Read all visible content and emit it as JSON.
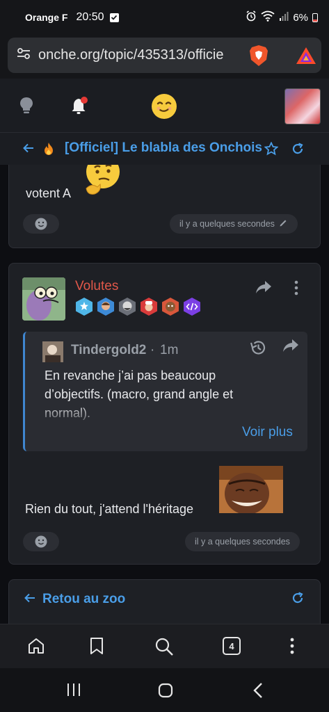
{
  "status_bar": {
    "carrier": "Orange F",
    "time": "20:50",
    "battery": "6%"
  },
  "browser": {
    "url": "onche.org/topic/435313/officie",
    "tab_count": "4"
  },
  "topic": {
    "title": "[Officiel] Le blabla des Onchois"
  },
  "posts": [
    {
      "text": "votent A",
      "time": "il y a quelques secondes"
    },
    {
      "author": "Volutes",
      "quote": {
        "author": "Tindergold2",
        "separator": "·",
        "time": "1m",
        "text": "En revanche j’ai pas beaucoup d’objectifs. (macro, grand angle et normal).",
        "more_label": "Voir plus"
      },
      "text": "Rien du tout, j'attend l'héritage",
      "time": "il y a quelques secondes"
    }
  ],
  "footer_link": {
    "label": "Retou au zoo"
  },
  "colors": {
    "accent": "#4a9ee8",
    "author": "#e2584a",
    "card": "#1e2025"
  },
  "icons": [
    "lightbulb-icon",
    "bell-icon",
    "smiley-icon",
    "fire-icon",
    "star-icon",
    "refresh-icon",
    "share-icon",
    "more-vertical-icon",
    "history-icon",
    "home-icon",
    "bookmark-icon",
    "search-icon"
  ]
}
